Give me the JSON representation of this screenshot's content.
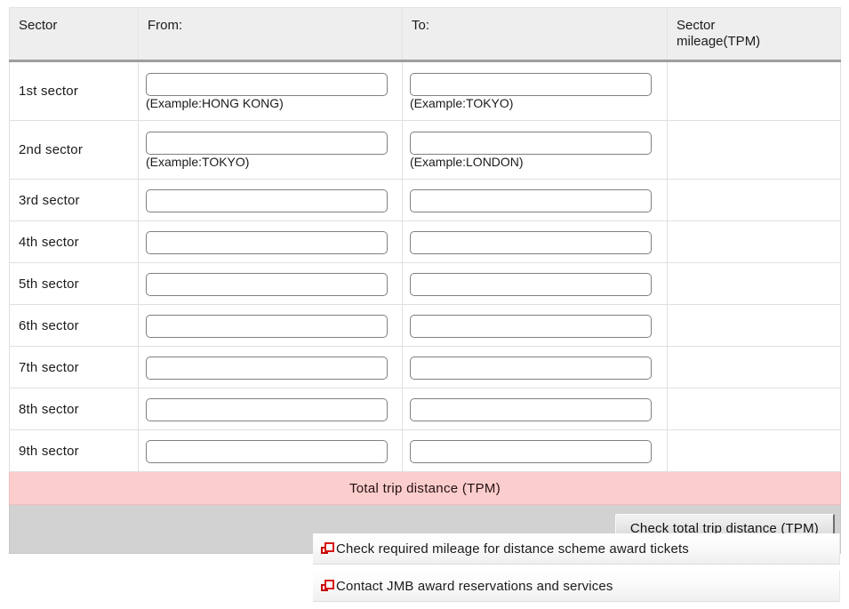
{
  "table": {
    "headers": {
      "sector": "Sector",
      "from": "From:",
      "to": "To:",
      "mileage_line1": "Sector",
      "mileage_line2": "mileage(TPM)"
    },
    "rows": [
      {
        "label": "1st sector",
        "from_value": "",
        "from_example": "(Example:HONG KONG)",
        "to_value": "",
        "to_example": "(Example:TOKYO)",
        "mileage": ""
      },
      {
        "label": "2nd sector",
        "from_value": "",
        "from_example": "(Example:TOKYO)",
        "to_value": "",
        "to_example": "(Example:LONDON)",
        "mileage": ""
      },
      {
        "label": "3rd sector",
        "from_value": "",
        "from_example": "",
        "to_value": "",
        "to_example": "",
        "mileage": ""
      },
      {
        "label": "4th sector",
        "from_value": "",
        "from_example": "",
        "to_value": "",
        "to_example": "",
        "mileage": ""
      },
      {
        "label": "5th sector",
        "from_value": "",
        "from_example": "",
        "to_value": "",
        "to_example": "",
        "mileage": ""
      },
      {
        "label": "6th sector",
        "from_value": "",
        "from_example": "",
        "to_value": "",
        "to_example": "",
        "mileage": ""
      },
      {
        "label": "7th sector",
        "from_value": "",
        "from_example": "",
        "to_value": "",
        "to_example": "",
        "mileage": ""
      },
      {
        "label": "8th sector",
        "from_value": "",
        "from_example": "",
        "to_value": "",
        "to_example": "",
        "mileage": ""
      },
      {
        "label": "9th sector",
        "from_value": "",
        "from_example": "",
        "to_value": "",
        "to_example": "",
        "mileage": ""
      }
    ],
    "total_row_label": "Total trip distance (TPM)",
    "total_row_color": "#fccdcd"
  },
  "actions": {
    "check_button_label": "Check total trip distance (TPM)"
  },
  "links": [
    {
      "icon": "new-window-icon",
      "label": "Check required mileage for distance scheme award tickets"
    },
    {
      "icon": "new-window-icon",
      "label": "Contact JMB award reservations and services"
    }
  ]
}
